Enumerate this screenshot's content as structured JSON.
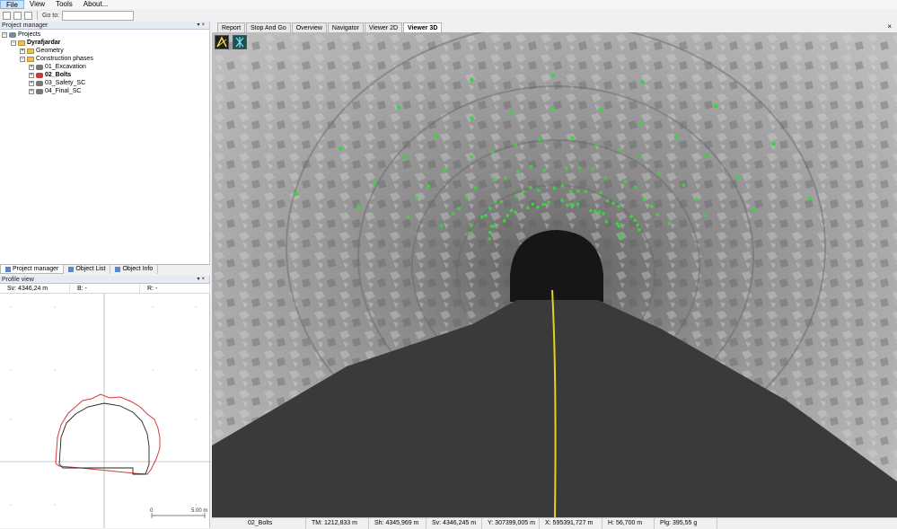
{
  "menu": {
    "items": [
      "File",
      "View",
      "Tools",
      "About..."
    ]
  },
  "toolbar": {
    "goto_label": "Go to:",
    "goto_value": ""
  },
  "project_manager": {
    "title": "Project manager",
    "tree": [
      {
        "label": "Projects",
        "bold": false
      },
      {
        "label": "Dyrafjardar",
        "bold": true
      },
      {
        "label": "Geometry",
        "bold": false
      },
      {
        "label": "Construction phases",
        "bold": false
      },
      {
        "label": "01_Excavation",
        "bold": false
      },
      {
        "label": "02_Bolts",
        "bold": true
      },
      {
        "label": "03_Safety_SC",
        "bold": false
      },
      {
        "label": "04_Final_SC",
        "bold": false
      }
    ]
  },
  "left_tabs": [
    "Project manager",
    "Object List",
    "Object Info"
  ],
  "profile_view": {
    "title": "Profile view",
    "sv": "Sv: 4346,24 m",
    "b": "B: -",
    "r": "R: -",
    "scale_start": "0",
    "scale_end": "5.00 m"
  },
  "viewer_tabs": [
    "Report",
    "Stop And Go",
    "Overview",
    "Navigator",
    "Viewer 2D",
    "Viewer 3D"
  ],
  "active_viewer_tab": "Viewer 3D",
  "status": {
    "object": "02_Bolts",
    "tm": "TM: 1212,833 m",
    "sh": "Sh: 4345,969 m",
    "sv": "Sv: 4346,245 m",
    "y": "Y: 307399,005 m",
    "x": "X: 595391,727 m",
    "h": "H: 56,700 m",
    "plg": "Plg: 395,55 g"
  },
  "colors": {
    "bolt_green": "#3fd23f",
    "centerline_yellow": "#e6d21e",
    "profile_red": "#d83a3a",
    "road": "#3a3a3a"
  }
}
